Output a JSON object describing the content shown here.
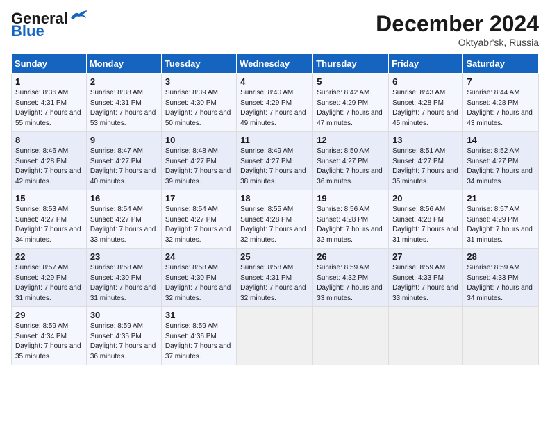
{
  "logo": {
    "general": "General",
    "blue": "Blue"
  },
  "header": {
    "month": "December 2024",
    "location": "Oktyabr'sk, Russia"
  },
  "weekdays": [
    "Sunday",
    "Monday",
    "Tuesday",
    "Wednesday",
    "Thursday",
    "Friday",
    "Saturday"
  ],
  "weeks": [
    [
      {
        "day": "1",
        "sunrise": "8:36 AM",
        "sunset": "4:31 PM",
        "daylight": "7 hours and 55 minutes."
      },
      {
        "day": "2",
        "sunrise": "8:38 AM",
        "sunset": "4:31 PM",
        "daylight": "7 hours and 53 minutes."
      },
      {
        "day": "3",
        "sunrise": "8:39 AM",
        "sunset": "4:30 PM",
        "daylight": "7 hours and 50 minutes."
      },
      {
        "day": "4",
        "sunrise": "8:40 AM",
        "sunset": "4:29 PM",
        "daylight": "7 hours and 49 minutes."
      },
      {
        "day": "5",
        "sunrise": "8:42 AM",
        "sunset": "4:29 PM",
        "daylight": "7 hours and 47 minutes."
      },
      {
        "day": "6",
        "sunrise": "8:43 AM",
        "sunset": "4:28 PM",
        "daylight": "7 hours and 45 minutes."
      },
      {
        "day": "7",
        "sunrise": "8:44 AM",
        "sunset": "4:28 PM",
        "daylight": "7 hours and 43 minutes."
      }
    ],
    [
      {
        "day": "8",
        "sunrise": "8:46 AM",
        "sunset": "4:28 PM",
        "daylight": "7 hours and 42 minutes."
      },
      {
        "day": "9",
        "sunrise": "8:47 AM",
        "sunset": "4:27 PM",
        "daylight": "7 hours and 40 minutes."
      },
      {
        "day": "10",
        "sunrise": "8:48 AM",
        "sunset": "4:27 PM",
        "daylight": "7 hours and 39 minutes."
      },
      {
        "day": "11",
        "sunrise": "8:49 AM",
        "sunset": "4:27 PM",
        "daylight": "7 hours and 38 minutes."
      },
      {
        "day": "12",
        "sunrise": "8:50 AM",
        "sunset": "4:27 PM",
        "daylight": "7 hours and 36 minutes."
      },
      {
        "day": "13",
        "sunrise": "8:51 AM",
        "sunset": "4:27 PM",
        "daylight": "7 hours and 35 minutes."
      },
      {
        "day": "14",
        "sunrise": "8:52 AM",
        "sunset": "4:27 PM",
        "daylight": "7 hours and 34 minutes."
      }
    ],
    [
      {
        "day": "15",
        "sunrise": "8:53 AM",
        "sunset": "4:27 PM",
        "daylight": "7 hours and 34 minutes."
      },
      {
        "day": "16",
        "sunrise": "8:54 AM",
        "sunset": "4:27 PM",
        "daylight": "7 hours and 33 minutes."
      },
      {
        "day": "17",
        "sunrise": "8:54 AM",
        "sunset": "4:27 PM",
        "daylight": "7 hours and 32 minutes."
      },
      {
        "day": "18",
        "sunrise": "8:55 AM",
        "sunset": "4:28 PM",
        "daylight": "7 hours and 32 minutes."
      },
      {
        "day": "19",
        "sunrise": "8:56 AM",
        "sunset": "4:28 PM",
        "daylight": "7 hours and 32 minutes."
      },
      {
        "day": "20",
        "sunrise": "8:56 AM",
        "sunset": "4:28 PM",
        "daylight": "7 hours and 31 minutes."
      },
      {
        "day": "21",
        "sunrise": "8:57 AM",
        "sunset": "4:29 PM",
        "daylight": "7 hours and 31 minutes."
      }
    ],
    [
      {
        "day": "22",
        "sunrise": "8:57 AM",
        "sunset": "4:29 PM",
        "daylight": "7 hours and 31 minutes."
      },
      {
        "day": "23",
        "sunrise": "8:58 AM",
        "sunset": "4:30 PM",
        "daylight": "7 hours and 31 minutes."
      },
      {
        "day": "24",
        "sunrise": "8:58 AM",
        "sunset": "4:30 PM",
        "daylight": "7 hours and 32 minutes."
      },
      {
        "day": "25",
        "sunrise": "8:58 AM",
        "sunset": "4:31 PM",
        "daylight": "7 hours and 32 minutes."
      },
      {
        "day": "26",
        "sunrise": "8:59 AM",
        "sunset": "4:32 PM",
        "daylight": "7 hours and 33 minutes."
      },
      {
        "day": "27",
        "sunrise": "8:59 AM",
        "sunset": "4:33 PM",
        "daylight": "7 hours and 33 minutes."
      },
      {
        "day": "28",
        "sunrise": "8:59 AM",
        "sunset": "4:33 PM",
        "daylight": "7 hours and 34 minutes."
      }
    ],
    [
      {
        "day": "29",
        "sunrise": "8:59 AM",
        "sunset": "4:34 PM",
        "daylight": "7 hours and 35 minutes."
      },
      {
        "day": "30",
        "sunrise": "8:59 AM",
        "sunset": "4:35 PM",
        "daylight": "7 hours and 36 minutes."
      },
      {
        "day": "31",
        "sunrise": "8:59 AM",
        "sunset": "4:36 PM",
        "daylight": "7 hours and 37 minutes."
      },
      null,
      null,
      null,
      null
    ]
  ]
}
